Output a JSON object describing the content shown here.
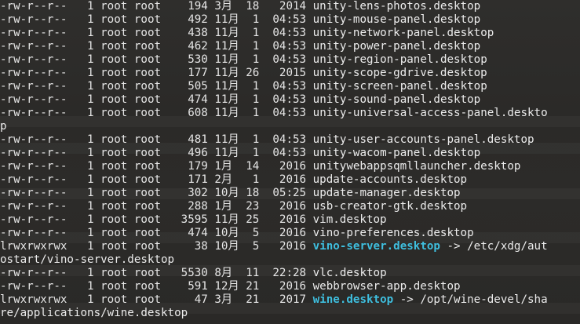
{
  "window": {
    "type": "terminal"
  },
  "colors": {
    "background": "#2b2a28",
    "text": "#e6e6e6",
    "symlink": "#3fbfdf"
  },
  "entries": [
    {
      "perm": "-rw-r--r--",
      "links": "1",
      "owner": "root",
      "group": "root",
      "size": "194",
      "month": "3月",
      "day": "18",
      "time": "2014",
      "name": "unity-lens-photos.desktop",
      "is_link": false
    },
    {
      "perm": "-rw-r--r--",
      "links": "1",
      "owner": "root",
      "group": "root",
      "size": "492",
      "month": "11月",
      "day": "1",
      "time": "04:53",
      "name": "unity-mouse-panel.desktop",
      "is_link": false
    },
    {
      "perm": "-rw-r--r--",
      "links": "1",
      "owner": "root",
      "group": "root",
      "size": "438",
      "month": "11月",
      "day": "1",
      "time": "04:53",
      "name": "unity-network-panel.desktop",
      "is_link": false
    },
    {
      "perm": "-rw-r--r--",
      "links": "1",
      "owner": "root",
      "group": "root",
      "size": "462",
      "month": "11月",
      "day": "1",
      "time": "04:53",
      "name": "unity-power-panel.desktop",
      "is_link": false
    },
    {
      "perm": "-rw-r--r--",
      "links": "1",
      "owner": "root",
      "group": "root",
      "size": "530",
      "month": "11月",
      "day": "1",
      "time": "04:53",
      "name": "unity-region-panel.desktop",
      "is_link": false
    },
    {
      "perm": "-rw-r--r--",
      "links": "1",
      "owner": "root",
      "group": "root",
      "size": "177",
      "month": "11月",
      "day": "26",
      "time": "2015",
      "name": "unity-scope-gdrive.desktop",
      "is_link": false
    },
    {
      "perm": "-rw-r--r--",
      "links": "1",
      "owner": "root",
      "group": "root",
      "size": "505",
      "month": "11月",
      "day": "1",
      "time": "04:53",
      "name": "unity-screen-panel.desktop",
      "is_link": false
    },
    {
      "perm": "-rw-r--r--",
      "links": "1",
      "owner": "root",
      "group": "root",
      "size": "474",
      "month": "11月",
      "day": "1",
      "time": "04:53",
      "name": "unity-sound-panel.desktop",
      "is_link": false
    },
    {
      "perm": "-rw-r--r--",
      "links": "1",
      "owner": "root",
      "group": "root",
      "size": "608",
      "month": "11月",
      "day": "1",
      "time": "04:53",
      "name": "unity-universal-access-panel.deskto",
      "is_link": false,
      "continuation": "p"
    },
    {
      "perm": "-rw-r--r--",
      "links": "1",
      "owner": "root",
      "group": "root",
      "size": "481",
      "month": "11月",
      "day": "1",
      "time": "04:53",
      "name": "unity-user-accounts-panel.desktop",
      "is_link": false
    },
    {
      "perm": "-rw-r--r--",
      "links": "1",
      "owner": "root",
      "group": "root",
      "size": "496",
      "month": "11月",
      "day": "1",
      "time": "04:53",
      "name": "unity-wacom-panel.desktop",
      "is_link": false
    },
    {
      "perm": "-rw-r--r--",
      "links": "1",
      "owner": "root",
      "group": "root",
      "size": "179",
      "month": "1月",
      "day": "14",
      "time": "2016",
      "name": "unitywebappsqmllauncher.desktop",
      "is_link": false
    },
    {
      "perm": "-rw-r--r--",
      "links": "1",
      "owner": "root",
      "group": "root",
      "size": "171",
      "month": "2月",
      "day": "1",
      "time": "2016",
      "name": "update-accounts.desktop",
      "is_link": false
    },
    {
      "perm": "-rw-r--r--",
      "links": "1",
      "owner": "root",
      "group": "root",
      "size": "302",
      "month": "10月",
      "day": "18",
      "time": "05:25",
      "name": "update-manager.desktop",
      "is_link": false
    },
    {
      "perm": "-rw-r--r--",
      "links": "1",
      "owner": "root",
      "group": "root",
      "size": "288",
      "month": "1月",
      "day": "23",
      "time": "2016",
      "name": "usb-creator-gtk.desktop",
      "is_link": false
    },
    {
      "perm": "-rw-r--r--",
      "links": "1",
      "owner": "root",
      "group": "root",
      "size": "3595",
      "month": "11月",
      "day": "25",
      "time": "2016",
      "name": "vim.desktop",
      "is_link": false
    },
    {
      "perm": "-rw-r--r--",
      "links": "1",
      "owner": "root",
      "group": "root",
      "size": "474",
      "month": "10月",
      "day": "5",
      "time": "2016",
      "name": "vino-preferences.desktop",
      "is_link": false
    },
    {
      "perm": "lrwxrwxrwx",
      "links": "1",
      "owner": "root",
      "group": "root",
      "size": "38",
      "month": "10月",
      "day": "5",
      "time": "2016",
      "name": "vino-server.desktop",
      "is_link": true,
      "arrow": "->",
      "target": "/etc/xdg/aut",
      "continuation": "ostart/vino-server.desktop"
    },
    {
      "perm": "-rw-r--r--",
      "links": "1",
      "owner": "root",
      "group": "root",
      "size": "5530",
      "month": "8月",
      "day": "11",
      "time": "22:28",
      "name": "vlc.desktop",
      "is_link": false
    },
    {
      "perm": "-rw-r--r--",
      "links": "1",
      "owner": "root",
      "group": "root",
      "size": "591",
      "month": "12月",
      "day": "21",
      "time": "2016",
      "name": "webbrowser-app.desktop",
      "is_link": false
    },
    {
      "perm": "lrwxrwxrwx",
      "links": "1",
      "owner": "root",
      "group": "root",
      "size": "47",
      "month": "3月",
      "day": "21",
      "time": "2017",
      "name": "wine.desktop",
      "is_link": true,
      "arrow": "->",
      "target": "/opt/wine-devel/sha",
      "continuation": "re/applications/wine.desktop"
    }
  ]
}
